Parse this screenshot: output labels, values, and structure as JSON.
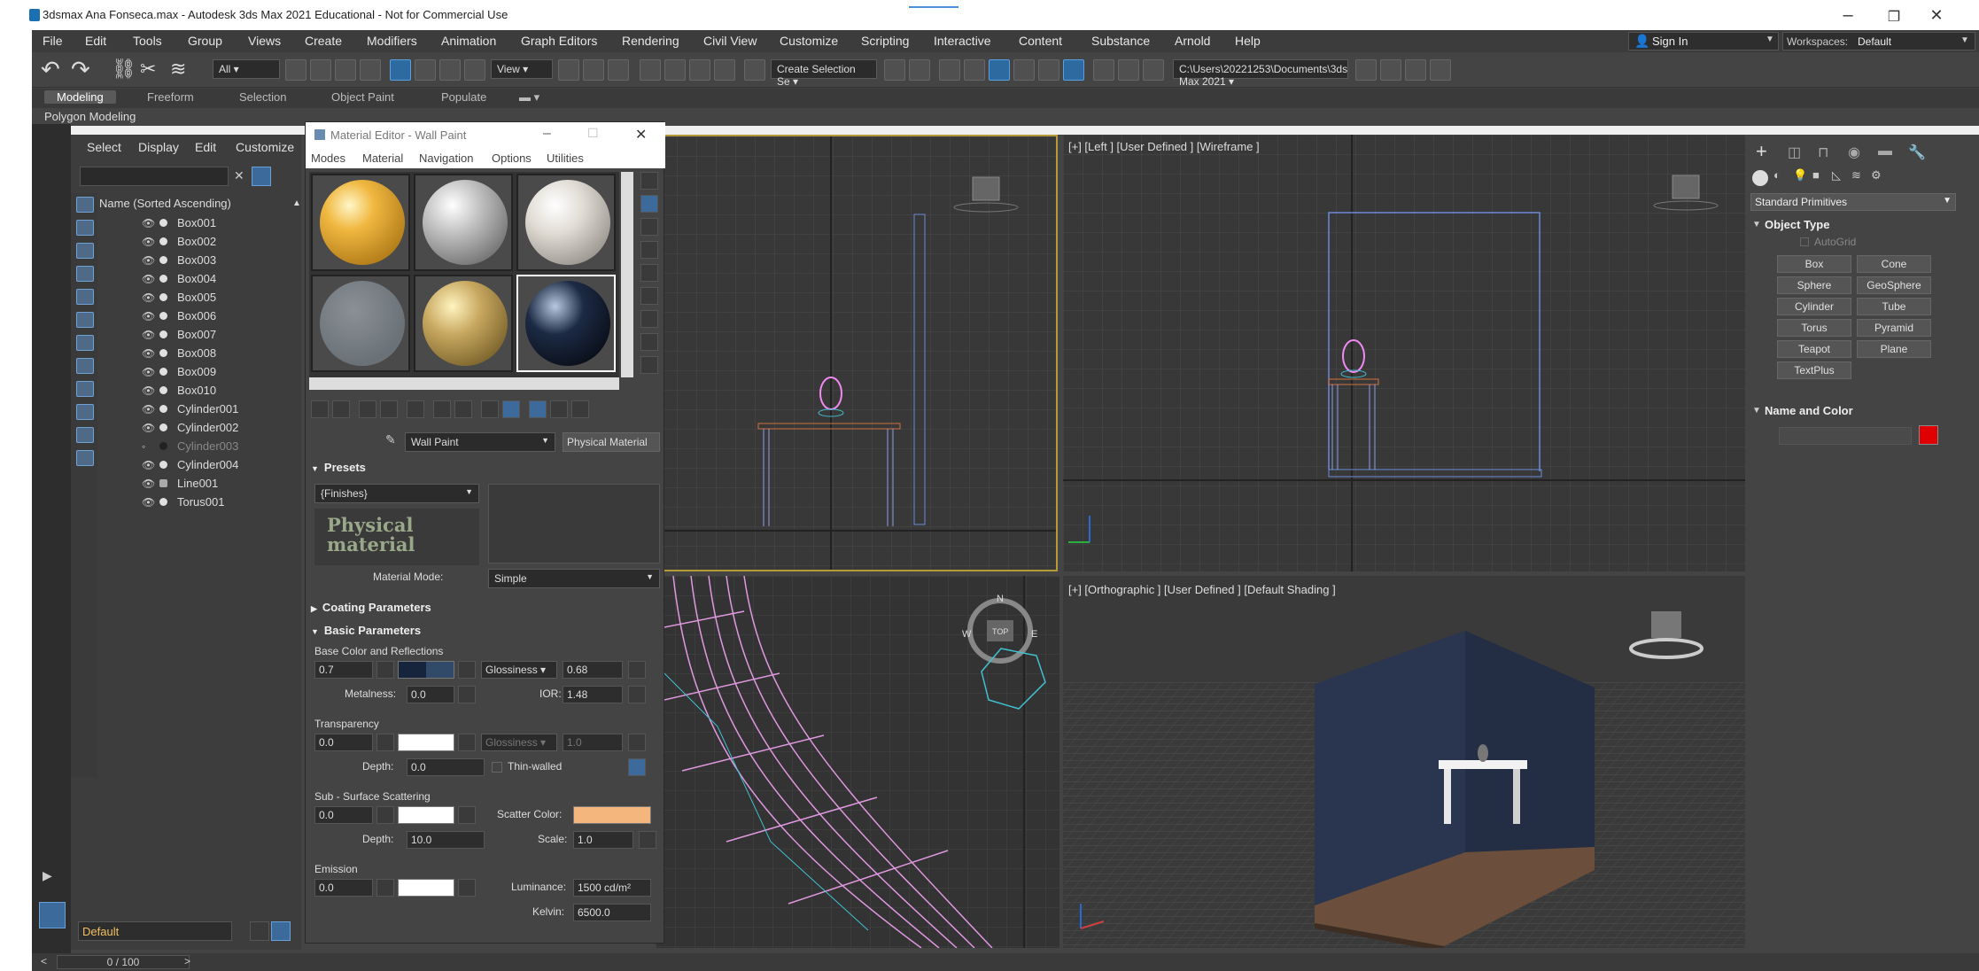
{
  "window": {
    "title": "3dsmax Ana Fonseca.max - Autodesk 3ds Max 2021 Educational - Not for Commercial Use",
    "min": "–",
    "max": "❐",
    "close": "✕"
  },
  "menu": [
    "File",
    "Edit",
    "Tools",
    "Group",
    "Views",
    "Create",
    "Modifiers",
    "Animation",
    "Graph Editors",
    "Rendering",
    "Civil View",
    "Customize",
    "Scripting",
    "Interactive",
    "Content",
    "Substance",
    "Arnold",
    "Help"
  ],
  "signin": "Sign In",
  "workspaces": {
    "label": "Workspaces:",
    "value": "Default"
  },
  "toolbar": {
    "filter": "All",
    "refcoord": "View",
    "selection_set": "Create Selection Se",
    "path": "C:\\Users\\20221253\\Documents\\3ds Max 2021"
  },
  "ribbon": {
    "tabs": [
      "Modeling",
      "Freeform",
      "Selection",
      "Object Paint",
      "Populate"
    ],
    "sub": "Polygon Modeling"
  },
  "scene_explorer": {
    "menu": [
      "Select",
      "Display",
      "Edit",
      "Customize"
    ],
    "header": "Name (Sorted Ascending)",
    "items": [
      "Box001",
      "Box002",
      "Box003",
      "Box004",
      "Box005",
      "Box006",
      "Box007",
      "Box008",
      "Box009",
      "Box010",
      "Cylinder001",
      "Cylinder002",
      "Cylinder003",
      "Cylinder004",
      "Line001",
      "Torus001"
    ]
  },
  "material_editor": {
    "title": "Material Editor - Wall Paint",
    "menu": [
      "Modes",
      "Material",
      "Navigation",
      "Options",
      "Utilities"
    ],
    "material_name": "Wall Paint",
    "material_type": "Physical Material",
    "presets": {
      "title": "Presets",
      "dropdown": "{Finishes}",
      "logo": "Physical material",
      "mode_label": "Material Mode:",
      "mode_value": "Simple"
    },
    "coating": "Coating Parameters",
    "basic": {
      "title": "Basic Parameters",
      "base_group": "Base Color and Reflections",
      "base_weight": "0.7",
      "gloss_label": "Glossiness",
      "gloss_value": "0.68",
      "metal_label": "Metalness:",
      "metal_value": "0.0",
      "ior_label": "IOR:",
      "ior_value": "1.48",
      "transp_group": "Transparency",
      "transp_value": "0.0",
      "transp_gloss_label": "Glossiness",
      "transp_gloss_value": "1.0",
      "depth_label": "Depth:",
      "depth_value": "0.0",
      "thin_label": "Thin-walled",
      "sss_group": "Sub - Surface Scattering",
      "sss_value": "0.0",
      "scatter_label": "Scatter Color:",
      "sss_depth_label": "Depth:",
      "sss_depth_value": "10.0",
      "scale_label": "Scale:",
      "scale_value": "1.0",
      "emission_group": "Emission",
      "emission_value": "0.0",
      "lum_label": "Luminance:",
      "lum_value": "1500 cd/m²",
      "kelvin_label": "Kelvin:",
      "kelvin_value": "6500.0"
    }
  },
  "viewports": {
    "left_label": "[+] [Left ] [User Defined ] [Wireframe ]",
    "persp_label": "[+] [Orthographic ] [User Defined ] [Default Shading ]",
    "compass": {
      "n": "N",
      "w": "W",
      "e": "E",
      "top": "TOP"
    }
  },
  "command_panel": {
    "category": "Standard Primitives",
    "object_type": "Object Type",
    "autogrid": "AutoGrid",
    "buttons": [
      "Box",
      "Cone",
      "Sphere",
      "GeoSphere",
      "Cylinder",
      "Tube",
      "Torus",
      "Pyramid",
      "Teapot",
      "Plane",
      "TextPlus"
    ],
    "name_color": "Name and Color",
    "color": "#e00000"
  },
  "bottom": {
    "layer": "Default",
    "time": "0 / 100"
  }
}
